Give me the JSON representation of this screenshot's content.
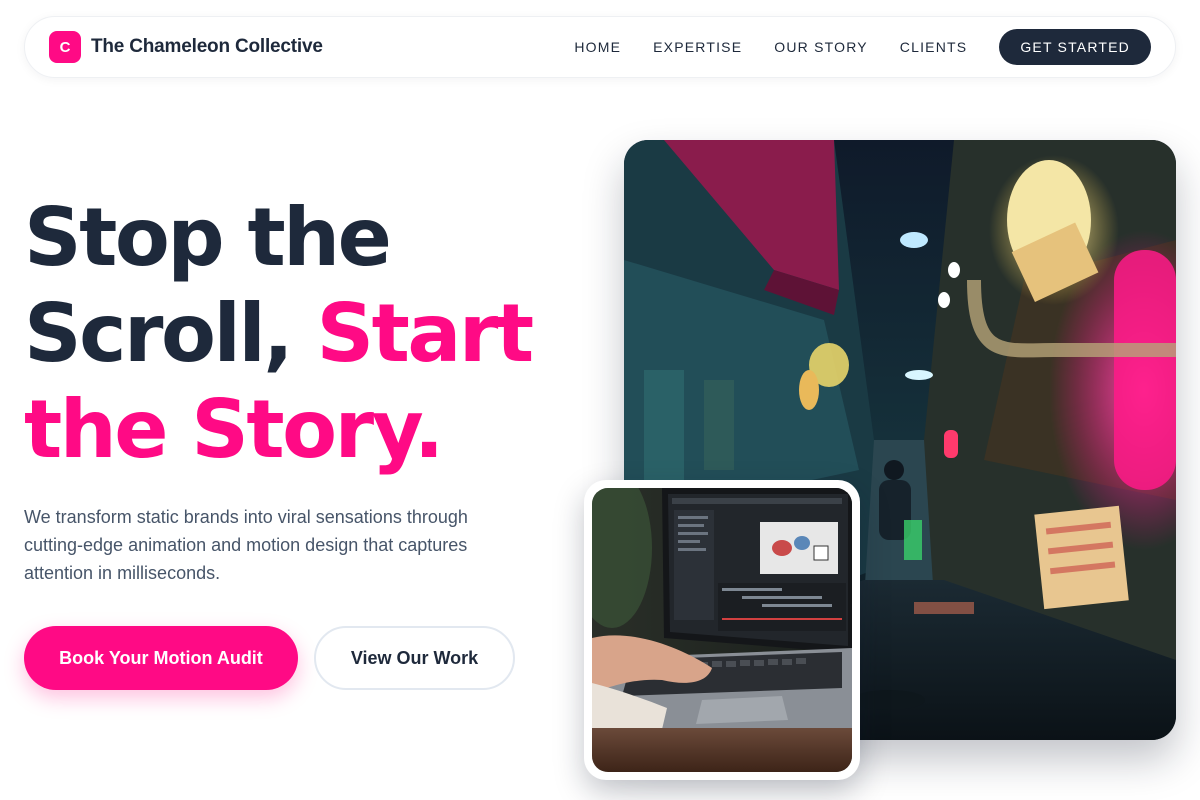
{
  "header": {
    "logo_letter": "C",
    "brand_name": "The Chameleon Collective",
    "nav": [
      {
        "label": "HOME"
      },
      {
        "label": "EXPERTISE"
      },
      {
        "label": "OUR STORY"
      },
      {
        "label": "CLIENTS"
      }
    ],
    "cta_label": "GET STARTED"
  },
  "hero": {
    "title_line1": "Stop the",
    "title_line2_dark": "Scroll, ",
    "title_line2_accent": "Start",
    "title_line3_accent": "the Story.",
    "subtitle": "We transform static brands into viral sensations through cutting-edge animation and motion design that captures attention in milliseconds.",
    "primary_button": "Book Your Motion Audit",
    "secondary_button": "View Our Work"
  },
  "images": {
    "main_alt": "Neon-lit alley at night",
    "inset_alt": "Hands working on a laptop with animation software"
  },
  "colors": {
    "accent": "#ff0a85",
    "dark": "#1e293b",
    "muted": "#475569"
  }
}
